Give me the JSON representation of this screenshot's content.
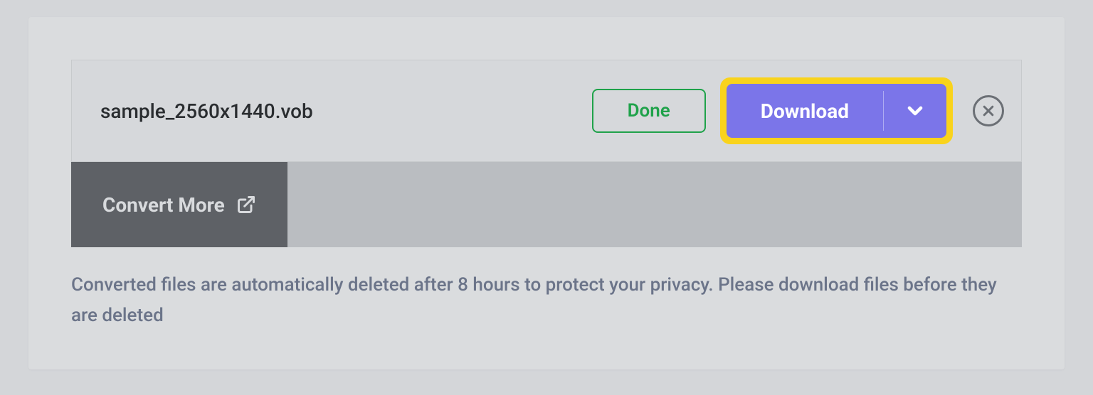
{
  "file": {
    "name": "sample_2560x1440.vob",
    "status": "Done"
  },
  "actions": {
    "download_label": "Download",
    "convert_more_label": "Convert More"
  },
  "notice": "Converted files are automatically deleted after 8 hours to protect your privacy. Please download files before they are deleted"
}
